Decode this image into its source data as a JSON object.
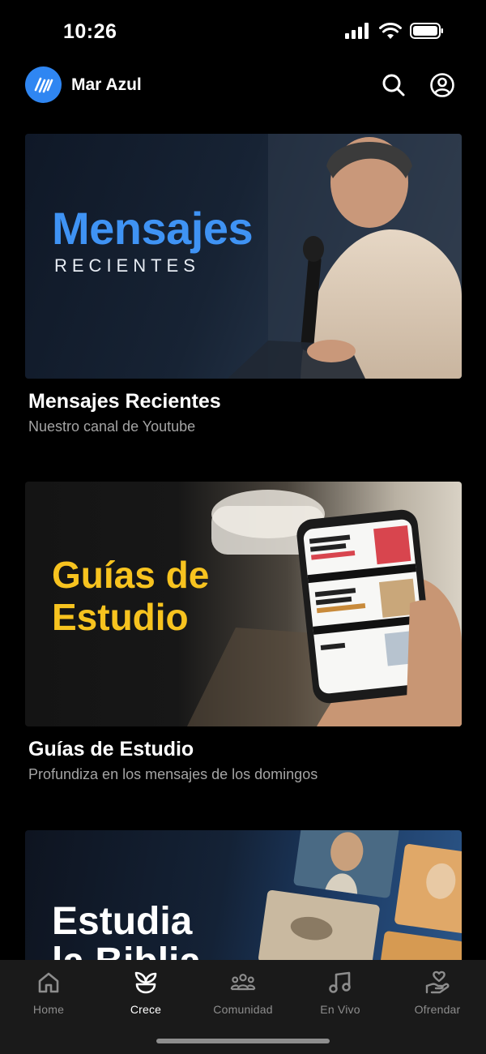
{
  "status_bar": {
    "time": "10:26"
  },
  "header": {
    "app_name": "Mar Azul",
    "logo_icon": "wave-logo-icon",
    "search_icon": "search-icon",
    "profile_icon": "user-circle-icon"
  },
  "cards": [
    {
      "image_title": "Mensajes",
      "image_subtitle": "RECIENTES",
      "title": "Mensajes Recientes",
      "subtitle": "Nuestro canal de Youtube"
    },
    {
      "image_title_line1": "Guías de",
      "image_title_line2": "Estudio",
      "title": "Guías de Estudio",
      "subtitle": "Profundiza en los mensajes de los domingos"
    },
    {
      "image_title_line1": "Estudia",
      "image_title_line2": "la Biblia"
    }
  ],
  "tab_bar": {
    "tabs": [
      {
        "label": "Home",
        "icon": "home-icon"
      },
      {
        "label": "Crece",
        "icon": "sprout-icon"
      },
      {
        "label": "Comunidad",
        "icon": "community-icon"
      },
      {
        "label": "En Vivo",
        "icon": "music-note-icon"
      },
      {
        "label": "Ofrendar",
        "icon": "giving-hand-icon"
      }
    ],
    "active": "Crece"
  },
  "colors": {
    "accent": "#2f86f2",
    "heading_blue": "#3f93f4",
    "heading_yellow": "#f7c31f",
    "background": "#000000",
    "tab_bar_bg": "#1a1a1a",
    "inactive_tab": "#8d8d8d"
  }
}
